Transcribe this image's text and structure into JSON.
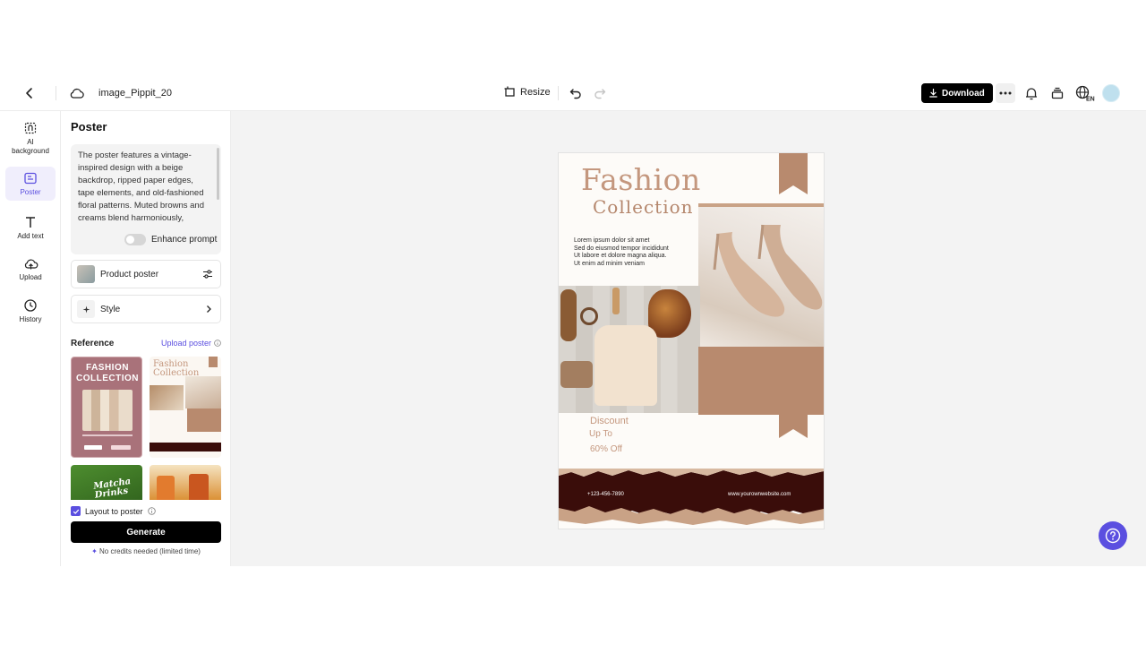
{
  "header": {
    "file_name": "image_Pippit_20",
    "resize_label": "Resize",
    "download_label": "Download"
  },
  "rail": {
    "items": [
      {
        "label": "AI background",
        "icon": "ai-background-icon"
      },
      {
        "label": "Poster",
        "icon": "poster-icon",
        "active": true
      },
      {
        "label": "Add text",
        "icon": "text-icon"
      },
      {
        "label": "Upload",
        "icon": "upload-icon"
      },
      {
        "label": "History",
        "icon": "history-icon"
      }
    ]
  },
  "panel": {
    "title": "Poster",
    "prompt": "The poster features a vintage-inspired design with a beige backdrop, ripped paper edges, tape elements, and old-fashioned floral patterns. Muted browns and creams blend harmoniously,",
    "enhance_label": "Enhance prompt",
    "enhance_on": false,
    "product_poster_label": "Product poster",
    "style_label": "Style",
    "reference_label": "Reference",
    "upload_poster_label": "Upload poster",
    "reference_thumbs": [
      {
        "title": "FASHION COLLECTION"
      },
      {
        "title": "Fashion Collection"
      },
      {
        "title": "Matcha Drinks"
      },
      {
        "title": ""
      }
    ],
    "layout_label": "Layout to poster",
    "layout_checked": true,
    "generate_label": "Generate",
    "credits_note": "No credits needed (limited time)"
  },
  "poster": {
    "title_line1": "Fashion",
    "title_line2": "Collection",
    "lorem": [
      "Lorem ipsum dolor sit amet",
      "Sed do eiusmod tempor incididunt",
      "Ut labore et dolore magna aliqua.",
      "Ut enim ad minim veniam"
    ],
    "discount": "Discount",
    "up_to": "Up To",
    "off": "60% Off",
    "phone": "+123-456-7890",
    "website": "www.yourownwebsite.com"
  },
  "colors": {
    "accent": "#5b4fe0",
    "poster_tan": "#c4977e",
    "poster_dark": "#3a0d0a"
  }
}
